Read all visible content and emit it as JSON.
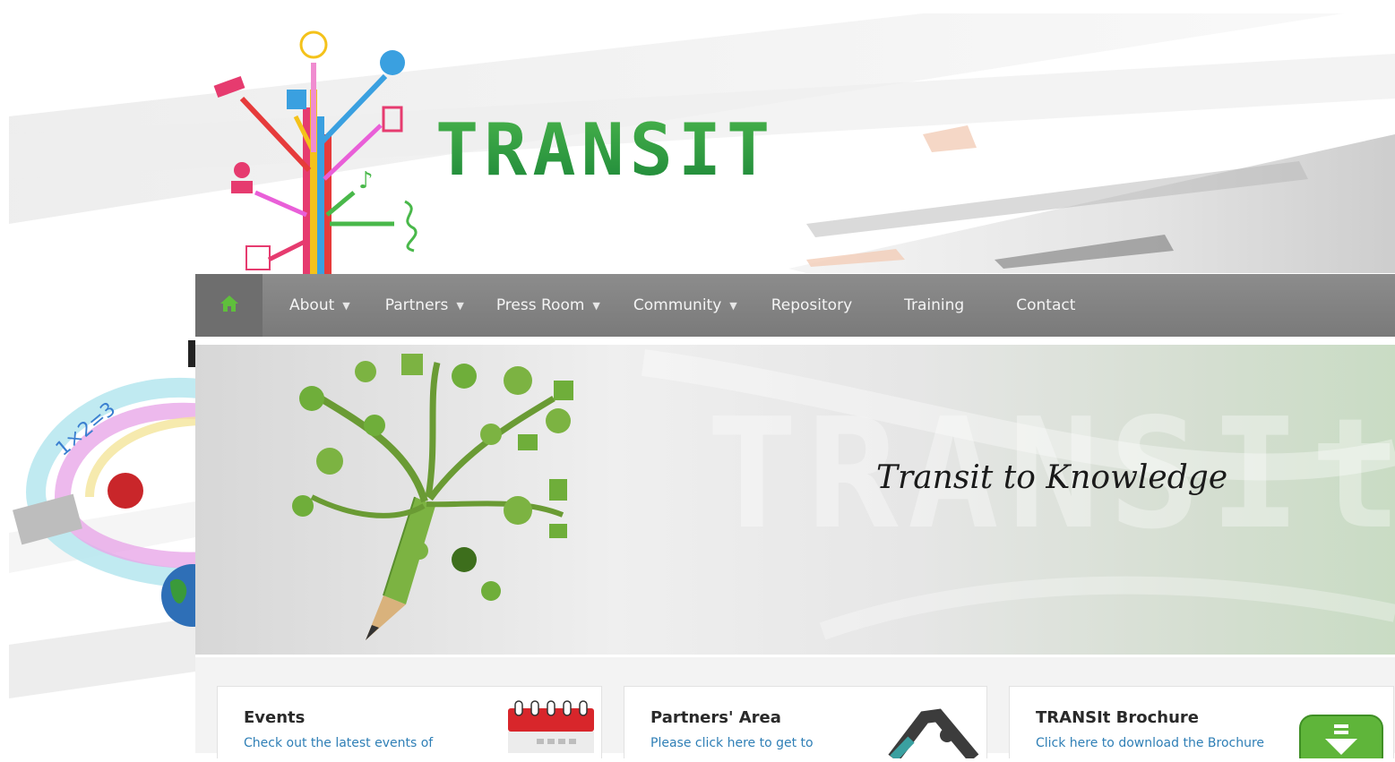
{
  "brand": {
    "name": "TRANSIT"
  },
  "nav": {
    "items": [
      {
        "label": "About",
        "has_dropdown": true
      },
      {
        "label": "Partners",
        "has_dropdown": true
      },
      {
        "label": "Press Room",
        "has_dropdown": true
      },
      {
        "label": "Community",
        "has_dropdown": true
      },
      {
        "label": "Repository",
        "has_dropdown": false
      },
      {
        "label": "Training",
        "has_dropdown": false
      },
      {
        "label": "Contact",
        "has_dropdown": false
      }
    ],
    "home_icon": "home-icon",
    "colors": {
      "bar": "#7f7f7f",
      "home_tab": "#6e6e6e",
      "home_icon": "#5fbf3c"
    }
  },
  "banner": {
    "tagline": "Transit to Knowledge",
    "watermark": "TRANSIt"
  },
  "cards": [
    {
      "title": "Events",
      "description": "Check out the latest events of",
      "icon": "calendar-icon"
    },
    {
      "title": "Partners' Area",
      "description": "Please click here to get to",
      "icon": "lock-icon"
    },
    {
      "title": "TRANSIt Brochure",
      "description": "Click here to download the Brochure",
      "icon": "download-icon"
    }
  ],
  "colors": {
    "brand_green": "#2f9a3a",
    "link_blue": "#2f7fb6"
  }
}
